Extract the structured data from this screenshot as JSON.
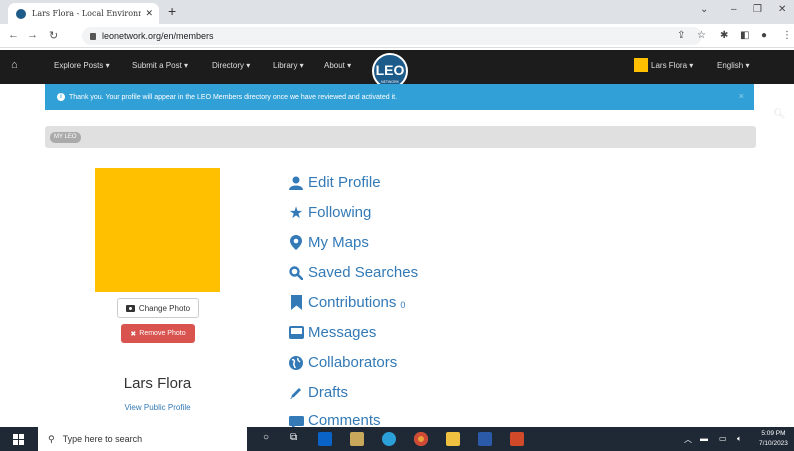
{
  "browser": {
    "tab_title": "Lars Flora - Local Environmental",
    "url": "leonetwork.org/en/members"
  },
  "navbar": {
    "items": [
      {
        "label": "Explore Posts"
      },
      {
        "label": "Submit a Post"
      },
      {
        "label": "Directory"
      },
      {
        "label": "Library"
      },
      {
        "label": "About"
      }
    ],
    "logo_text": "LEO",
    "logo_subtext": "NETWORK",
    "user_label": "Lars Flora",
    "language_label": "English"
  },
  "alert": {
    "message": "Thank you. Your profile will appear in the LEO Members directory once we have reviewed and activated it.",
    "close": "×"
  },
  "breadcrumb": {
    "label": "MY LEO"
  },
  "profile": {
    "change_photo": "Change Photo",
    "remove_photo": "Remove Photo",
    "name": "Lars Flora",
    "view_public": "View Public Profile",
    "photo_color": "#ffc000"
  },
  "menu": {
    "edit_profile": "Edit Profile",
    "following": "Following",
    "my_maps": "My Maps",
    "saved_searches": "Saved Searches",
    "contributions": "Contributions",
    "contributions_count": "0",
    "messages": "Messages",
    "collaborators": "Collaborators",
    "drafts": "Drafts",
    "comments": "Comments"
  },
  "taskbar": {
    "search_placeholder": "Type here to search",
    "time": "5:09 PM",
    "date": "7/10/2023"
  },
  "colors": {
    "accent": "#337ab7",
    "alert": "#31a0d6",
    "danger": "#d9534f",
    "navbar": "#1c1c1c"
  }
}
